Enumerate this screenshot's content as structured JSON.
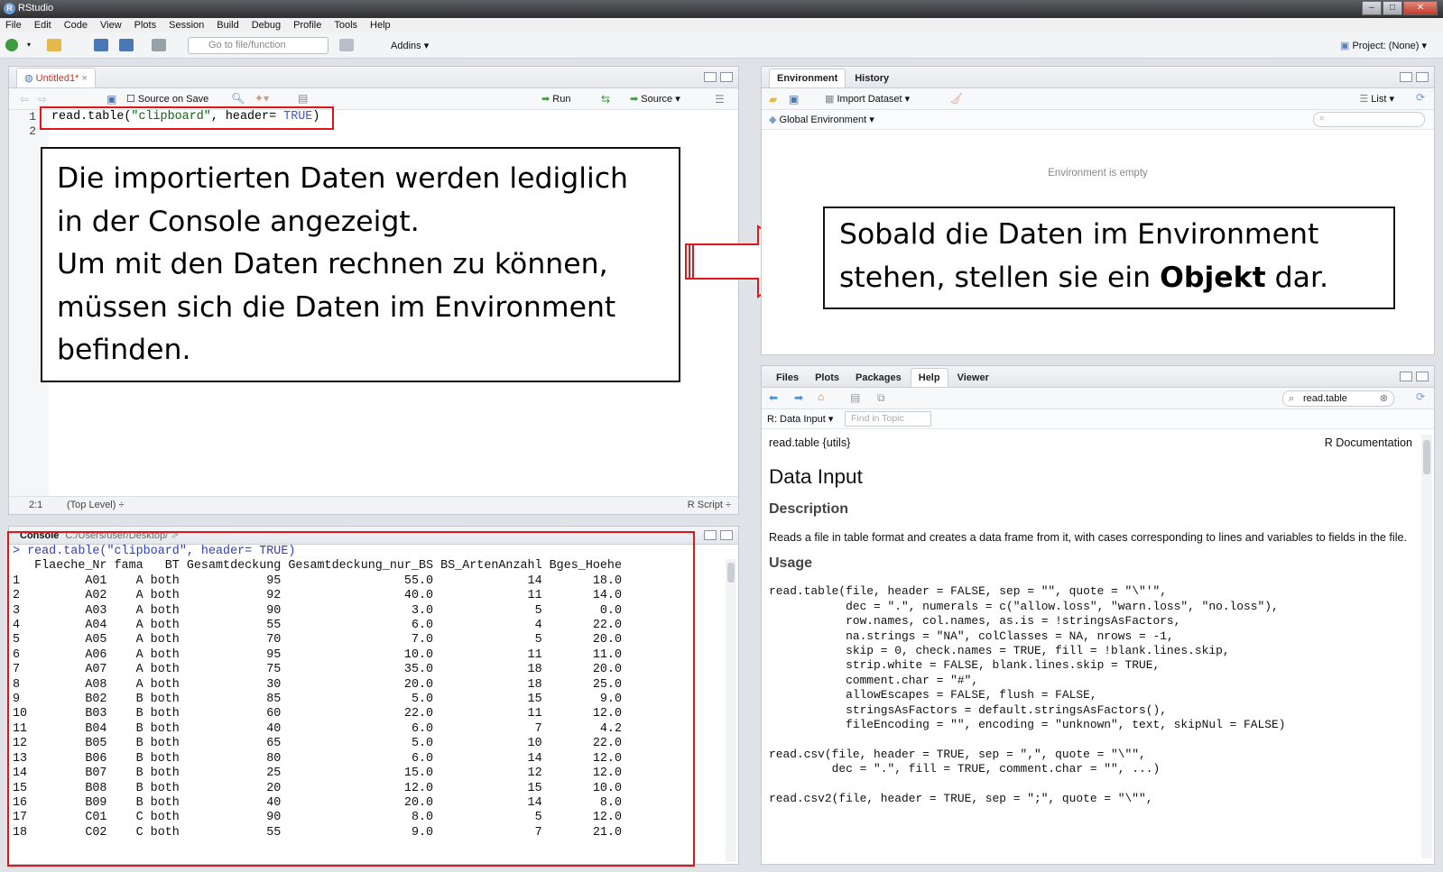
{
  "window": {
    "title": "RStudio"
  },
  "menu": [
    "File",
    "Edit",
    "Code",
    "View",
    "Plots",
    "Session",
    "Build",
    "Debug",
    "Profile",
    "Tools",
    "Help"
  ],
  "toolbar": {
    "goto_placeholder": "Go to file/function",
    "addins_label": "Addins",
    "project_label": "Project: (None)"
  },
  "editor": {
    "tab_label": "Untitled1*",
    "source_on_save": "Source on Save",
    "run_label": "Run",
    "source_label": "Source",
    "lines": [
      {
        "num": "1",
        "fn": "read.table(",
        "arg": "\"clipboard\"",
        "mid": ", header= ",
        "kw": "TRUE",
        "end": ")"
      },
      {
        "num": "2",
        "fn": "",
        "arg": "",
        "mid": "",
        "kw": "",
        "end": ""
      }
    ],
    "status_pos": "2:1",
    "status_level": "(Top Level) ÷",
    "status_type": "R Script ÷"
  },
  "callout_left": {
    "lines": [
      "Die importierten Daten werden lediglich",
      "in der Console angezeigt.",
      "Um mit den Daten rechnen zu können,",
      "müssen sich die Daten im Environment",
      "befinden."
    ]
  },
  "callout_right": {
    "line1": "Sobald die Daten im Environment",
    "line2_pre": "stehen, stellen sie ein ",
    "line2_bold": "Objekt",
    "line2_post": " dar."
  },
  "environment": {
    "tabs": [
      "Environment",
      "History"
    ],
    "import_label": "Import Dataset",
    "list_label": "List",
    "scope_label": "Global Environment",
    "empty_text": "Environment is empty"
  },
  "console": {
    "title": "Console",
    "path": "C:/Users/user/Desktop/",
    "command": "> read.table(\"clipboard\", header= TRUE)",
    "header": "   Flaeche_Nr fama   BT Gesamtdeckung Gesamtdeckung_nur_BS BS_ArtenAnzahl Bges_Hoehe",
    "rows": [
      "1         A01    A both            95                 55.0             14       18.0",
      "2         A02    A both            92                 40.0             11       14.0",
      "3         A03    A both            90                  3.0              5        0.0",
      "4         A04    A both            55                  6.0              4       22.0",
      "5         A05    A both            70                  7.0              5       20.0",
      "6         A06    A both            95                 10.0             11       11.0",
      "7         A07    A both            75                 35.0             18       20.0",
      "8         A08    A both            30                 20.0             18       25.0",
      "9         B02    B both            85                  5.0             15        9.0",
      "10        B03    B both            60                 22.0             11       12.0",
      "11        B04    B both            40                  6.0              7        4.2",
      "12        B05    B both            65                  5.0             10       22.0",
      "13        B06    B both            80                  6.0             14       12.0",
      "14        B07    B both            25                 15.0             12       12.0",
      "15        B08    B both            20                 12.0             15       10.0",
      "16        B09    B both            40                 20.0             14        8.0",
      "17        C01    C both            90                  8.0              5       12.0",
      "18        C02    C both            55                  9.0              7       21.0"
    ]
  },
  "help": {
    "tabs": [
      "Files",
      "Plots",
      "Packages",
      "Help",
      "Viewer"
    ],
    "search_value": "read.table",
    "topic_label": "R: Data Input",
    "find_placeholder": "Find in Topic",
    "doc_left": "read.table {utils}",
    "doc_right": "R Documentation",
    "heading": "Data Input",
    "description_heading": "Description",
    "description": "Reads a file in table format and creates a data frame from it, with cases corresponding to lines and variables to fields in the file.",
    "usage_heading": "Usage",
    "usage_lines": [
      "read.table(file, header = FALSE, sep = \"\", quote = \"\\\"'\",",
      "           dec = \".\", numerals = c(\"allow.loss\", \"warn.loss\", \"no.loss\"),",
      "           row.names, col.names, as.is = !stringsAsFactors,",
      "           na.strings = \"NA\", colClasses = NA, nrows = -1,",
      "           skip = 0, check.names = TRUE, fill = !blank.lines.skip,",
      "           strip.white = FALSE, blank.lines.skip = TRUE,",
      "           comment.char = \"#\",",
      "           allowEscapes = FALSE, flush = FALSE,",
      "           stringsAsFactors = default.stringsAsFactors(),",
      "           fileEncoding = \"\", encoding = \"unknown\", text, skipNul = FALSE)",
      "",
      "read.csv(file, header = TRUE, sep = \",\", quote = \"\\\"\",",
      "         dec = \".\", fill = TRUE, comment.char = \"\", ...)",
      "",
      "read.csv2(file, header = TRUE, sep = \";\", quote = \"\\\"\","
    ]
  }
}
